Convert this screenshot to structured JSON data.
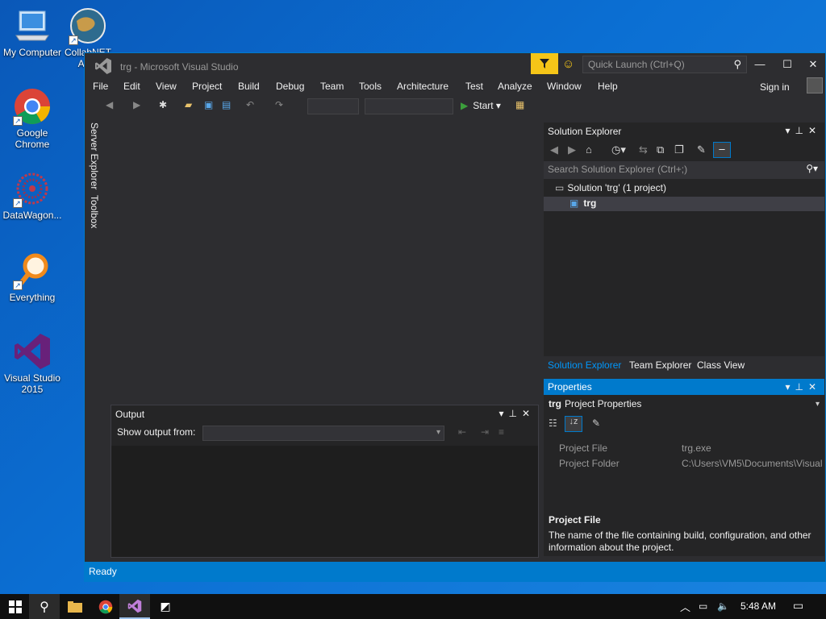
{
  "desktop": {
    "icons": [
      {
        "label": "My Computer"
      },
      {
        "label": "CollabNET Auth"
      },
      {
        "label": "Google Chrome"
      },
      {
        "label": "DataWagon..."
      },
      {
        "label": "Everything"
      },
      {
        "label": "Visual Studio 2015"
      }
    ]
  },
  "window": {
    "title": "trg - Microsoft Visual Studio",
    "quick_launch_placeholder": "Quick Launch (Ctrl+Q)",
    "menu": [
      "File",
      "Edit",
      "View",
      "Project",
      "Build",
      "Debug",
      "Team",
      "Tools",
      "Architecture",
      "Test",
      "Analyze",
      "Window",
      "Help"
    ],
    "sign_in": "Sign in",
    "toolbar": {
      "start_label": "Start"
    },
    "left_tabs": [
      "Server Explorer",
      "Toolbox"
    ],
    "status": "Ready"
  },
  "output": {
    "title": "Output",
    "show_from_label": "Show output from:"
  },
  "solution_explorer": {
    "title": "Solution Explorer",
    "search_placeholder": "Search Solution Explorer (Ctrl+;)",
    "solution": "Solution 'trg' (1 project)",
    "project": "trg",
    "tabs": [
      "Solution Explorer",
      "Team Explorer",
      "Class View"
    ]
  },
  "properties": {
    "title": "Properties",
    "object_name": "trg",
    "object_type": "Project Properties",
    "rows": [
      {
        "key": "Project File",
        "value": "trg.exe"
      },
      {
        "key": "Project Folder",
        "value": "C:\\Users\\VM5\\Documents\\Visual"
      }
    ],
    "desc_title": "Project File",
    "desc_text": "The name of the file containing build, configuration, and other information about the project."
  },
  "taskbar": {
    "time": "5:48 AM"
  },
  "colors": {
    "accent": "#007acc",
    "vs_purple": "#68217a",
    "filter_yellow": "#f5c518"
  }
}
